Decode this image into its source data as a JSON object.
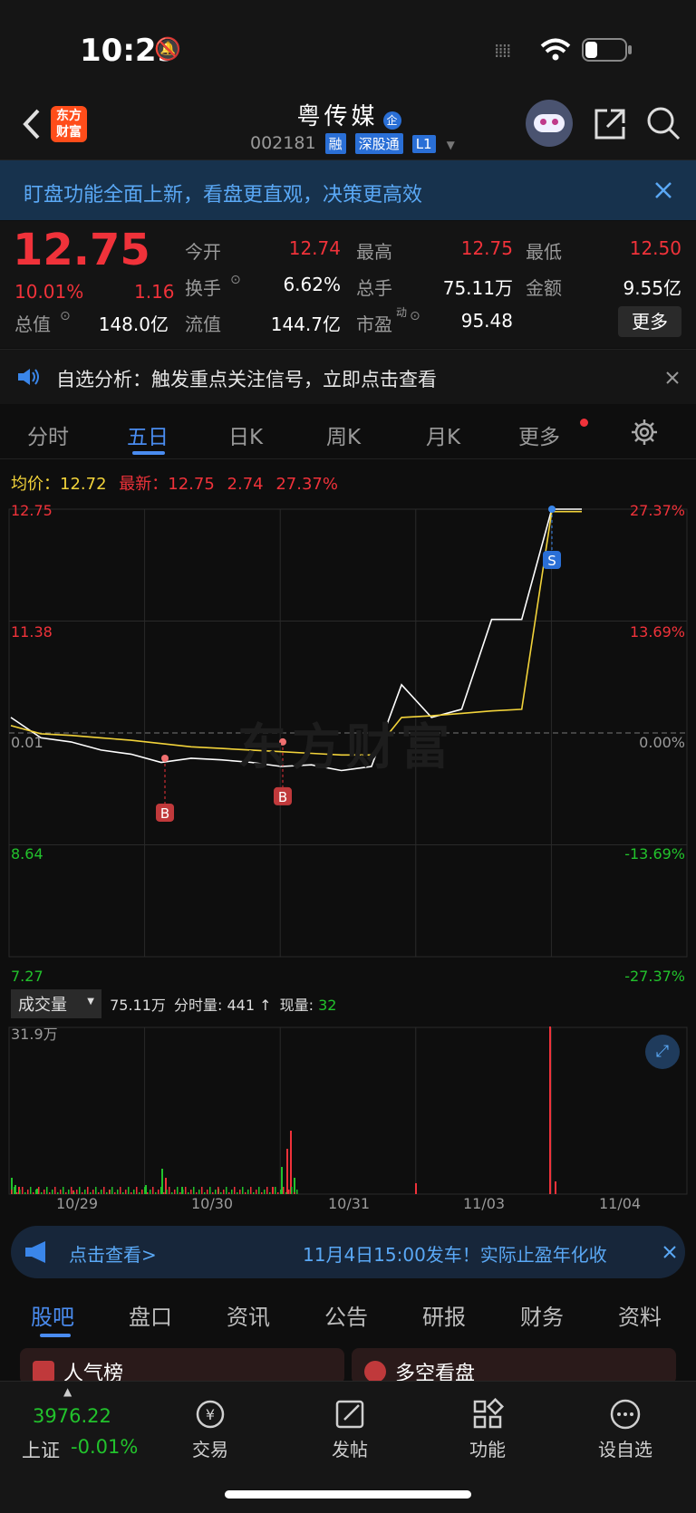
{
  "status_bar": {
    "time": "10:29"
  },
  "header": {
    "logo_line1": "东方",
    "logo_line2": "财富",
    "stock_name": "粤传媒",
    "enterprise_badge": "企",
    "stock_code": "002181",
    "tags": [
      "融",
      "深股通",
      "L1"
    ]
  },
  "banner": {
    "text": "盯盘功能全面上新，看盘更直观，决策更高效"
  },
  "quote": {
    "price": "12.75",
    "change_pct": "10.01%",
    "change_amt": "1.16",
    "fields": [
      {
        "label": "今开",
        "value": "12.74",
        "color": "#f0323a"
      },
      {
        "label": "最高",
        "value": "12.75",
        "color": "#f0323a"
      },
      {
        "label": "最低",
        "value": "12.50",
        "color": "#f0323a"
      },
      {
        "label": "换手",
        "value": "6.62%",
        "color": "#ffffff"
      },
      {
        "label": "总手",
        "value": "75.11万",
        "color": "#ffffff"
      },
      {
        "label": "金额",
        "value": "9.55亿",
        "color": "#ffffff"
      },
      {
        "label": "总值",
        "value": "148.0亿",
        "color": "#ffffff"
      },
      {
        "label": "流值",
        "value": "144.7亿",
        "color": "#ffffff"
      },
      {
        "label": "市盈",
        "value": "95.48",
        "color": "#ffffff"
      }
    ],
    "pe_superscript": "动",
    "more_button": "更多"
  },
  "notice": {
    "text": "自选分析：触发重点关注信号，立即点击查看"
  },
  "tabs": [
    "分时",
    "五日",
    "日K",
    "周K",
    "月K",
    "更多"
  ],
  "active_tab": "五日",
  "legend": {
    "avg_label": "均价：",
    "avg_value": "12.72",
    "latest_label": "最新：",
    "latest_value": "12.75",
    "change": "2.74",
    "change_pct": "27.37%"
  },
  "chart_data": {
    "type": "line",
    "y_left_ticks": [
      "12.75",
      "11.38",
      "0.01",
      "8.64",
      "7.27"
    ],
    "y_right_ticks": [
      "27.37%",
      "13.69%",
      "0.00%",
      "-13.69%",
      "-27.37%"
    ],
    "x_labels": [
      "10/29",
      "10/30",
      "10/31",
      "11/03",
      "11/04"
    ],
    "ylim": [
      7.27,
      12.75
    ],
    "series": [
      {
        "name": "最新",
        "values": [
          10.2,
          9.95,
          9.9,
          9.8,
          9.75,
          9.65,
          9.7,
          9.68,
          9.65,
          9.6,
          9.62,
          9.55,
          9.6,
          10.6,
          10.2,
          10.3,
          11.4,
          11.4,
          12.75,
          12.75
        ]
      },
      {
        "name": "均价",
        "values": [
          10.1,
          10.0,
          9.98,
          9.95,
          9.92,
          9.88,
          9.84,
          9.82,
          9.8,
          9.78,
          9.76,
          9.74,
          9.74,
          10.2,
          10.22,
          10.25,
          10.28,
          10.3,
          12.72,
          12.72
        ]
      }
    ],
    "markers": [
      {
        "label": "B",
        "price": 9.7
      },
      {
        "label": "B",
        "price": 9.9
      },
      {
        "label": "S",
        "price": 12.75
      }
    ]
  },
  "volume": {
    "selector": "成交量",
    "total": "75.11万",
    "detail_prefix": "分时量: 441",
    "arrow": "↑",
    "current_label": "现量:",
    "current_value": "32",
    "max_label": "31.9万"
  },
  "ticker": {
    "left": "点击查看>",
    "right": "11月4日15:00发车！实际止盈年化收"
  },
  "bottom_tabs": [
    "股吧",
    "盘口",
    "资讯",
    "公告",
    "研报",
    "财务",
    "资料"
  ],
  "active_bottom_tab": "股吧",
  "cards": {
    "left": "人气榜",
    "right": "多空看盘"
  },
  "bottom_nav": {
    "index_value": "3976.22",
    "index_name": "上证",
    "index_change": "-0.01%",
    "items": [
      "交易",
      "发帖",
      "功能",
      "设自选"
    ]
  },
  "watermark": "东方财富"
}
